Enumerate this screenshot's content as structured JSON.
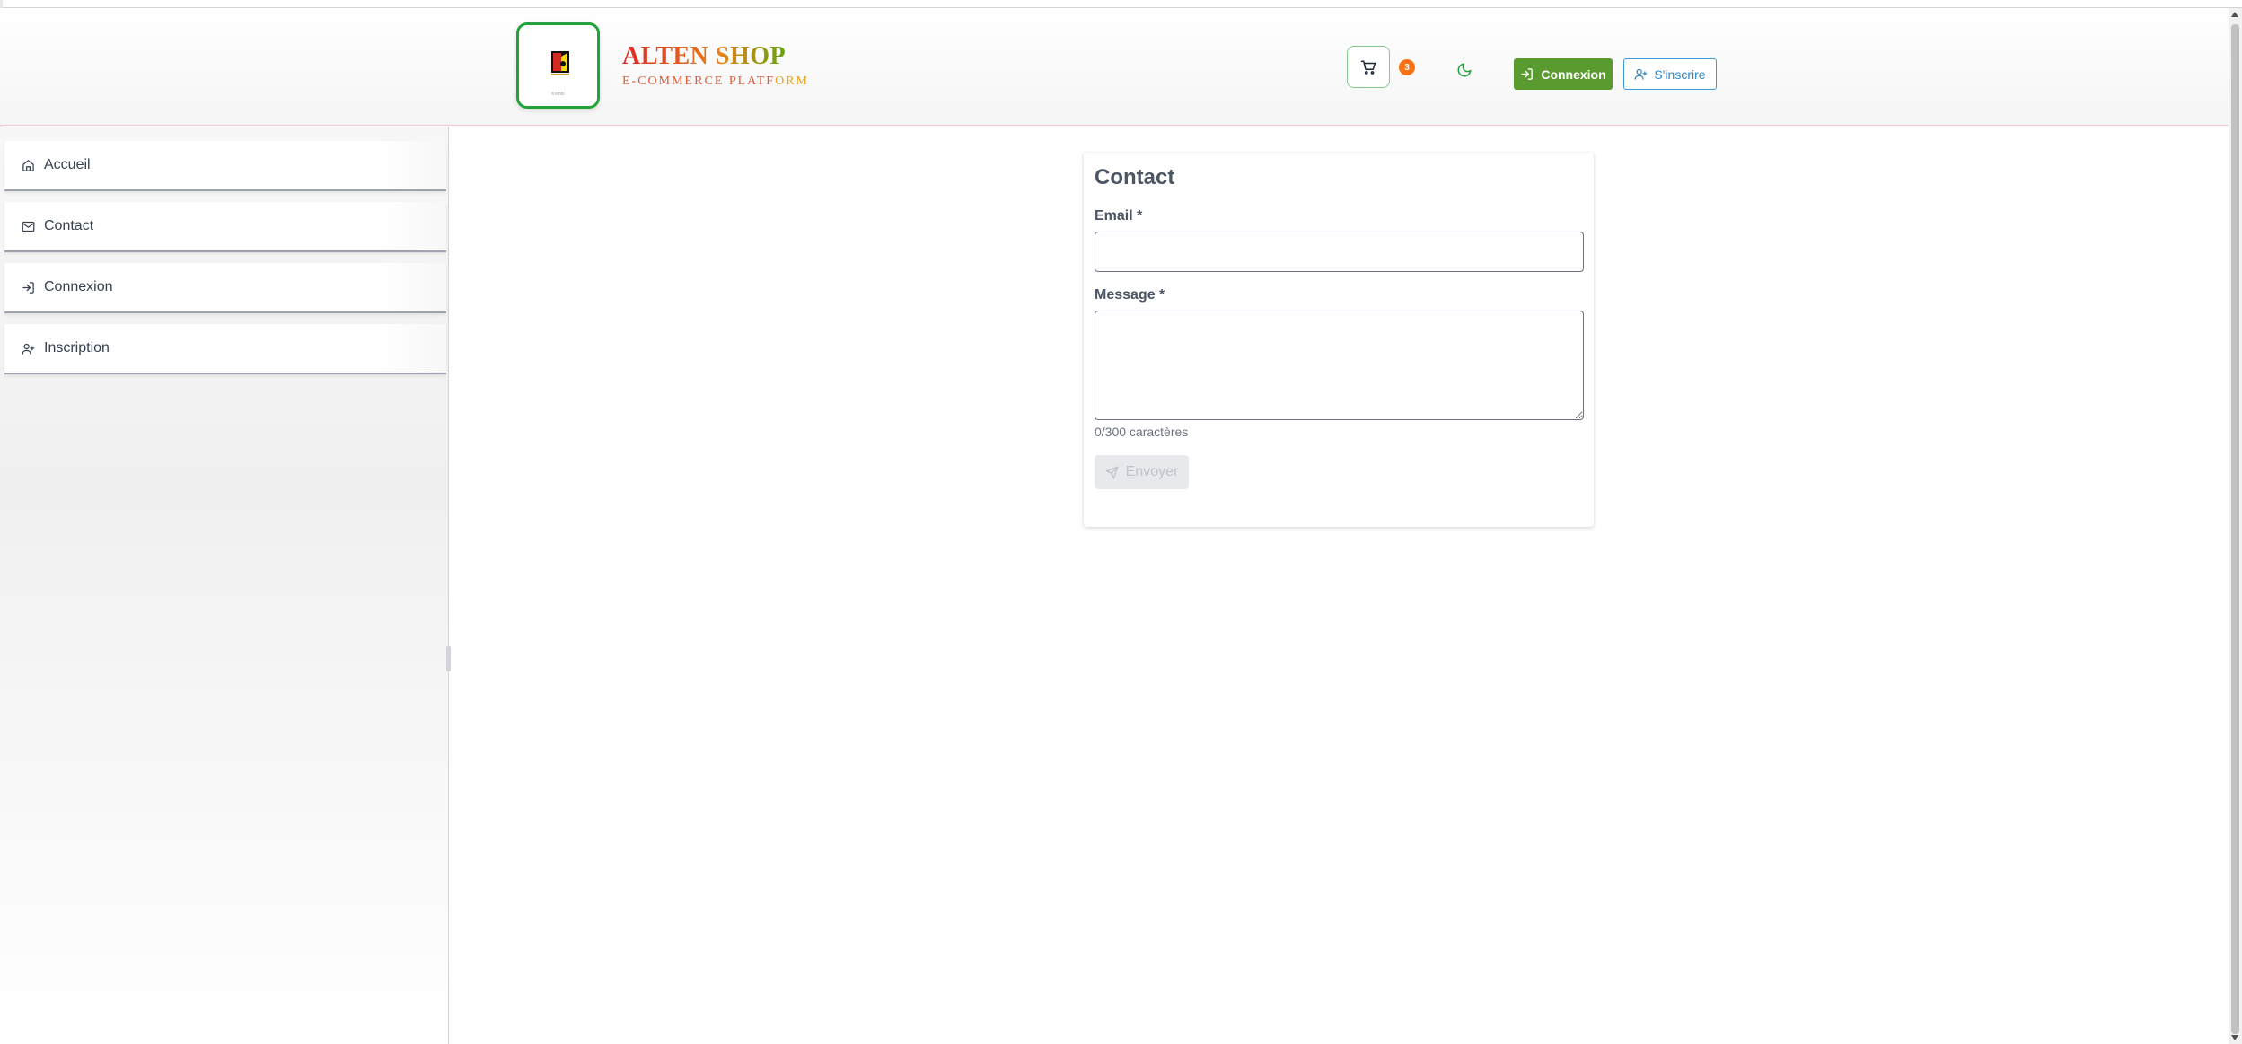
{
  "header": {
    "brand_title": "ALTEN SHOP",
    "brand_subtitle_main": "E-COMMERCE PLATF",
    "brand_subtitle_end": "ORM",
    "logo_caption": "Kombi",
    "cart_count": "3",
    "login_label": "Connexion",
    "signup_label": "S'inscrire",
    "icons": [
      "cart-icon",
      "moon-icon",
      "login-icon",
      "user-plus-icon"
    ]
  },
  "sidebar": {
    "items": [
      {
        "label": "Accueil",
        "icon": "home-icon"
      },
      {
        "label": "Contact",
        "icon": "mail-icon"
      },
      {
        "label": "Connexion",
        "icon": "login-icon"
      },
      {
        "label": "Inscription",
        "icon": "user-plus-icon"
      }
    ]
  },
  "contact_form": {
    "title": "Contact",
    "email_label": "Email *",
    "email_value": "",
    "message_label": "Message *",
    "message_value": "",
    "char_count": "0/300 caractères",
    "send_label": "Envoyer"
  },
  "colors": {
    "accent_green": "#5a9b2f",
    "accent_blue": "#2a87c8",
    "badge_orange": "#f97316",
    "logo_border": "#22a33a"
  }
}
